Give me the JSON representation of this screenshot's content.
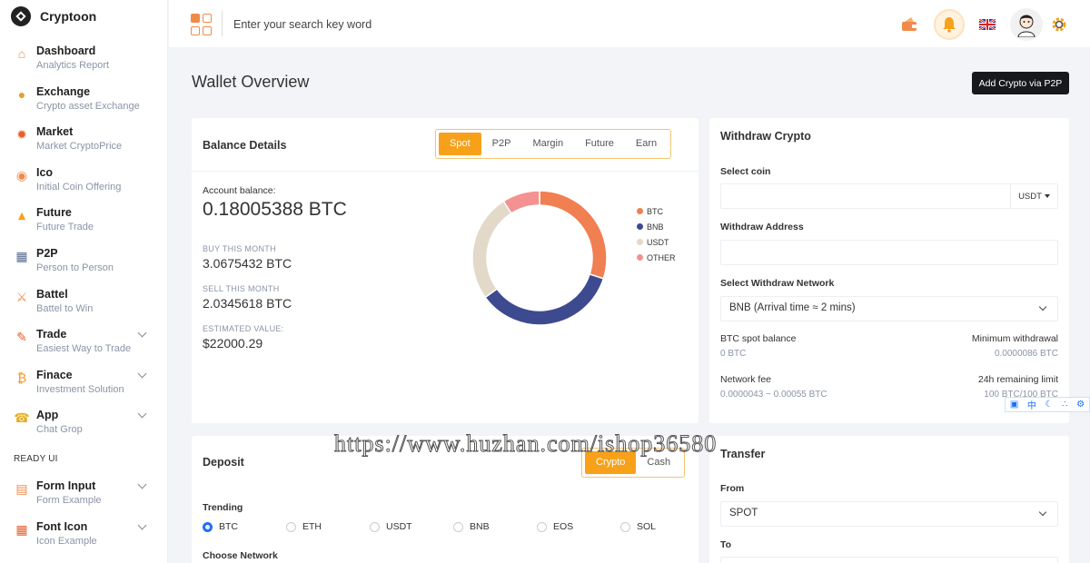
{
  "brand": {
    "name": "Cryptoon"
  },
  "sidebar": {
    "items": [
      {
        "title": "Dashboard",
        "sub": "Analytics Report",
        "icon": "home-icon",
        "chevron": false
      },
      {
        "title": "Exchange",
        "sub": "Crypto asset Exchange",
        "icon": "exchange-icon",
        "chevron": false
      },
      {
        "title": "Market",
        "sub": "Market CryptoPrice",
        "icon": "market-icon",
        "chevron": false
      },
      {
        "title": "Ico",
        "sub": "Initial Coin Offering",
        "icon": "ico-icon",
        "chevron": false
      },
      {
        "title": "Future",
        "sub": "Future Trade",
        "icon": "future-icon",
        "chevron": false
      },
      {
        "title": "P2P",
        "sub": "Person to Person",
        "icon": "p2p-icon",
        "chevron": false
      },
      {
        "title": "Battel",
        "sub": "Battel to Win",
        "icon": "battel-icon",
        "chevron": false
      },
      {
        "title": "Trade",
        "sub": "Easiest Way to Trade",
        "icon": "trade-icon",
        "chevron": true
      },
      {
        "title": "Finace",
        "sub": "Investment Solution",
        "icon": "bitcoin-icon",
        "chevron": true
      },
      {
        "title": "App",
        "sub": "Chat Grop",
        "icon": "chat-icon",
        "chevron": true
      }
    ],
    "section_label": "READY UI",
    "ready_items": [
      {
        "title": "Form Input",
        "sub": "Form Example",
        "icon": "form-icon",
        "chevron": true
      },
      {
        "title": "Font Icon",
        "sub": "Icon Example",
        "icon": "font-icon",
        "chevron": true
      }
    ]
  },
  "topbar": {
    "search_placeholder": "Enter your search key word"
  },
  "page": {
    "title": "Wallet Overview",
    "p2p_button": "Add Crypto via P2P"
  },
  "balance": {
    "title": "Balance Details",
    "tabs": [
      "Spot",
      "P2P",
      "Margin",
      "Future",
      "Earn"
    ],
    "active_tab": "Spot",
    "account_label": "Account balance:",
    "account_value": "0.18005388 BTC",
    "buy_label": "BUY THIS MONTH",
    "buy_value": "3.0675432 BTC",
    "sell_label": "SELL THIS MONTH",
    "sell_value": "2.0345618 BTC",
    "estimated_label": "ESTIMATED VALUE:",
    "estimated_value": "$22000.29"
  },
  "chart_data": {
    "type": "pie",
    "categories": [
      "BTC",
      "BNB",
      "USDT",
      "OTHER"
    ],
    "values": [
      30,
      35,
      26,
      9
    ],
    "colors": [
      "#f07f52",
      "#3d4a8f",
      "#e2d9c8",
      "#f49191"
    ],
    "legend_position": "right"
  },
  "withdraw": {
    "title": "Withdraw Crypto",
    "select_coin_label": "Select coin",
    "coin_value": "USDT",
    "address_label": "Withdraw Address",
    "network_label": "Select Withdraw Network",
    "network_value": "BNB (Arrival time ≈ 2 mins)",
    "spot_balance_label": "BTC spot balance",
    "spot_balance_value": "0 BTC",
    "min_withdraw_label": "Minimum withdrawal",
    "min_withdraw_value": "0.0000086 BTC",
    "fee_label": "Network fee",
    "fee_value": "0.0000043 ~ 0.00055 BTC",
    "limit_label": "24h remaining limit",
    "limit_value": "100 BTC/100 BTC"
  },
  "deposit": {
    "title": "Deposit",
    "tabs": [
      "Crypto",
      "Cash"
    ],
    "active_tab": "Crypto",
    "trending_label": "Trending",
    "coins": [
      "BTC",
      "ETH",
      "USDT",
      "BNB",
      "EOS",
      "SOL"
    ],
    "selected_coin": "BTC",
    "network_label": "Choose Network"
  },
  "transfer": {
    "title": "Transfer",
    "from_label": "From",
    "from_value": "SPOT",
    "to_label": "To"
  },
  "watermark": "https://www.huzhan.com/ishop36580",
  "mini_toolbar": [
    "中"
  ]
}
